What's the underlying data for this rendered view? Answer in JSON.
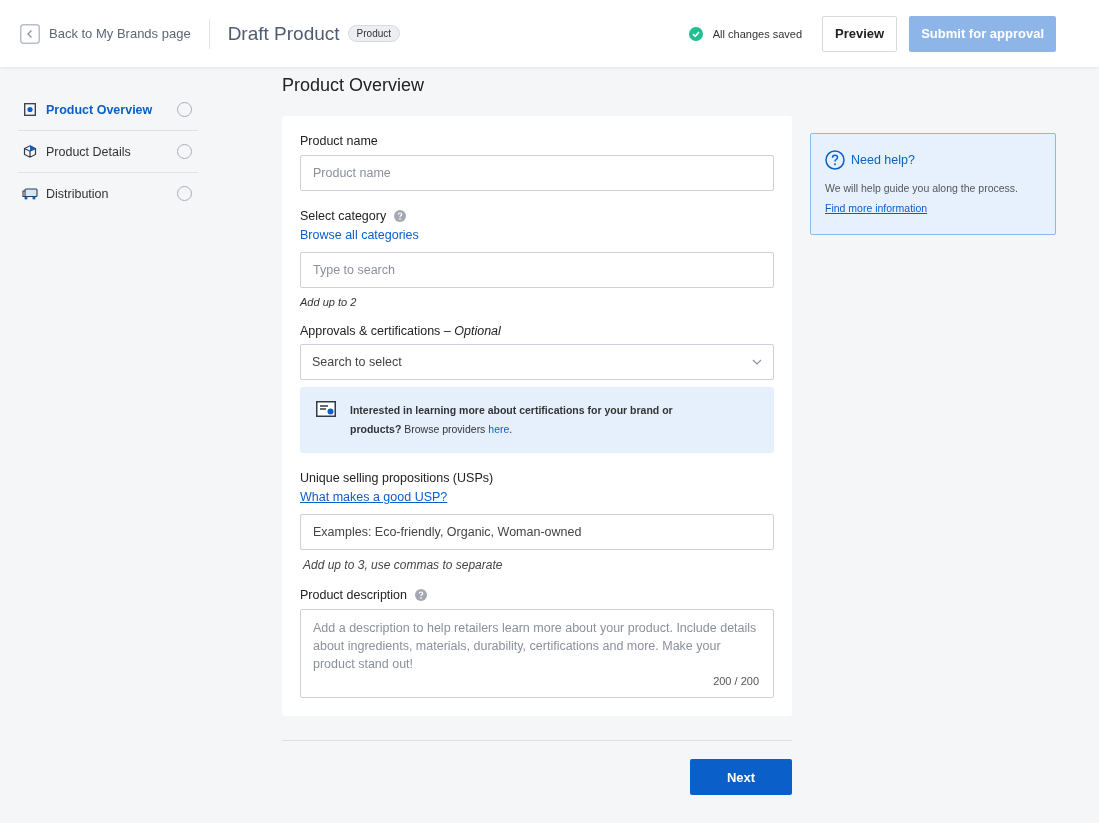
{
  "header": {
    "back_link": "Back to My Brands page",
    "title": "Draft Product",
    "badge": "Product",
    "save_status": "All changes saved",
    "preview_button": "Preview",
    "submit_button": {
      "label": "Submit for approval",
      "disabled": true
    }
  },
  "steps": [
    {
      "label": "Product Overview",
      "selected": true
    },
    {
      "label": "Product Details",
      "selected": false
    },
    {
      "label": "Distribution",
      "selected": false
    }
  ],
  "page_title": "Product Overview",
  "form": {
    "product_name": {
      "label": "Product name",
      "placeholder": "Product name"
    },
    "category": {
      "label": "Select category",
      "link": "Browse all categories",
      "placeholder": "Type to search",
      "hint": "Add up to 2"
    },
    "approvals": {
      "label": "Approvals & certifications – *Optional*",
      "placeholder": "Search to select"
    },
    "info_banner": {
      "text": "**Interested in learning more about certifications for your brand or products?** Browse providers ",
      "link": "here",
      "tail": "."
    },
    "usps": {
      "label": "Unique selling propositions (USPs)",
      "link": "What makes a good USP?",
      "placeholder": "Examples: Eco-friendly, Organic, Woman-owned",
      "hint": "Add up to 3, use commas to separate"
    },
    "description": {
      "label": "Product description",
      "placeholder": "Add a description to help retailers learn more about your product. Include details about ingredients, materials, durability, certifications and more. Make your product stand out!",
      "counter": "200 / 200"
    }
  },
  "next_button": "Next",
  "help": {
    "title": "Need help?",
    "text": "We will help guide you along the process.",
    "link": "Find more information"
  }
}
